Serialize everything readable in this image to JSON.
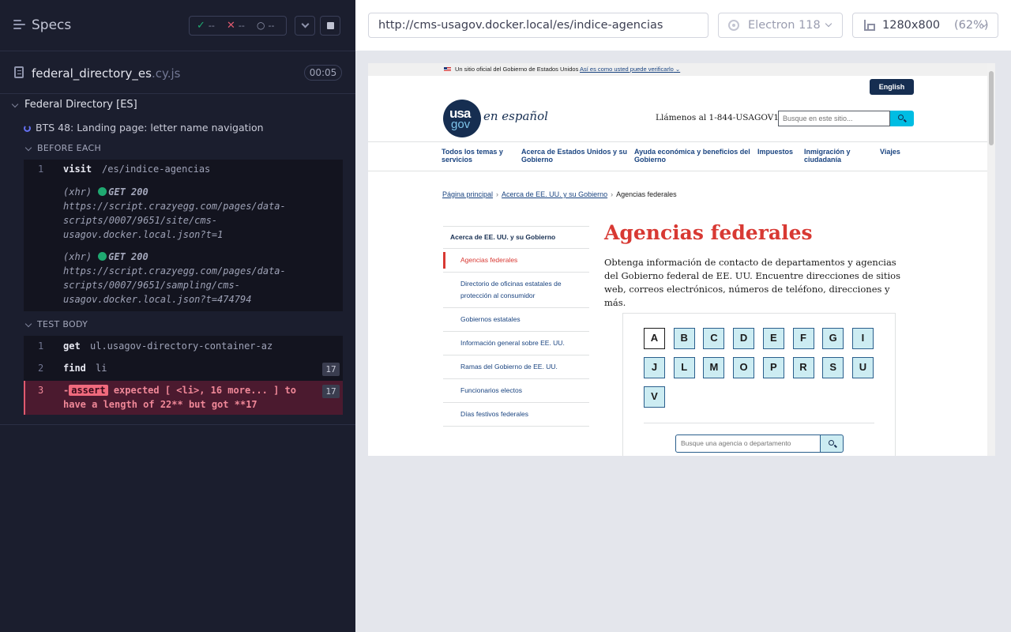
{
  "runner": {
    "header": {
      "title": "Specs"
    },
    "stats": {
      "passed": "--",
      "failed": "--",
      "pending": "--"
    },
    "spec": {
      "name": "federal_directory_es",
      "ext": ".cy.js",
      "duration": "00:05"
    },
    "suite": {
      "title": "Federal Directory [ES]"
    },
    "test": {
      "title": "BTS 48: Landing page: letter name navigation"
    },
    "before_each": {
      "label": "BEFORE EACH",
      "commands": [
        {
          "num": "1",
          "name": "visit",
          "message": "/es/indice-agencias"
        }
      ],
      "xhr": [
        {
          "tag": "(xhr)",
          "status": "GET 200",
          "url_lines": [
            "https://script.crazyegg.com/pages/data-",
            "scripts/0007/9651/site/cms-",
            "usagov.docker.local.json?t=1"
          ]
        },
        {
          "tag": "(xhr)",
          "status": "GET 200",
          "url_lines": [
            "https://script.crazyegg.com/pages/data-",
            "scripts/0007/9651/sampling/cms-",
            "usagov.docker.local.json?t=474794"
          ]
        }
      ]
    },
    "test_body": {
      "label": "TEST BODY",
      "commands": [
        {
          "num": "1",
          "name": "get",
          "message": "ul.usagov-directory-container-az"
        },
        {
          "num": "2",
          "name": "find",
          "message": "li",
          "count": "17"
        }
      ],
      "failure": {
        "num": "3",
        "prefix": "-",
        "name": "assert",
        "line1": " expected [ <li>, 16 more... ] to",
        "line2": "have a length of 22** but got **17",
        "count": "17"
      }
    }
  },
  "toolbar": {
    "url": "http://cms-usagov.docker.local/es/indice-agencias",
    "browser": "Electron 118",
    "viewport": "1280x800",
    "zoom": "(62%)"
  },
  "site": {
    "banner_text": "Un sitio oficial del Gobierno de Estados Unidos",
    "banner_link": "Así es como usted puede verificarlo",
    "english_button": "English",
    "logo_top": "usa",
    "logo_bottom": "gov",
    "logo_suffix": "en español",
    "phone": "Llámenos al 1-844-USAGOV1",
    "search_placeholder": "Busque en este sitio...",
    "nav": [
      {
        "line1": "Todos los temas y",
        "line2": "servicios"
      },
      {
        "line1": "Acerca de Estados Unidos y su",
        "line2": "Gobierno"
      },
      {
        "line1": "Ayuda económica y beneficios del",
        "line2": "Gobierno"
      },
      {
        "line1": "Impuestos",
        "line2": ""
      },
      {
        "line1": "Inmigración y",
        "line2": "ciudadanía"
      },
      {
        "line1": "Viajes",
        "line2": ""
      }
    ],
    "breadcrumbs": {
      "home": "Página principal",
      "parent": "Acerca de EE. UU. y su Gobierno",
      "current": "Agencias federales"
    },
    "sidenav": {
      "heading": "Acerca de EE. UU. y su Gobierno",
      "items": [
        "Agencias federales",
        "Directorio de oficinas estatales de protección al consumidor",
        "Gobiernos estatales",
        "Información general sobre EE. UU.",
        "Ramas del Gobierno de EE. UU.",
        "Funcionarios electos",
        "Días festivos federales"
      ]
    },
    "title": "Agencias federales",
    "intro": "Obtenga información de contacto de departamentos y agencias del Gobierno federal de EE. UU. Encuentre direcciones de sitios web, correos electrónicos, números de teléfono, direcciones y más.",
    "letters": [
      "A",
      "B",
      "C",
      "D",
      "E",
      "F",
      "G",
      "I",
      "J",
      "L",
      "M",
      "O",
      "P",
      "R",
      "S",
      "U",
      "V"
    ],
    "agency_search_placeholder": "Busque una agencia o departamento"
  }
}
